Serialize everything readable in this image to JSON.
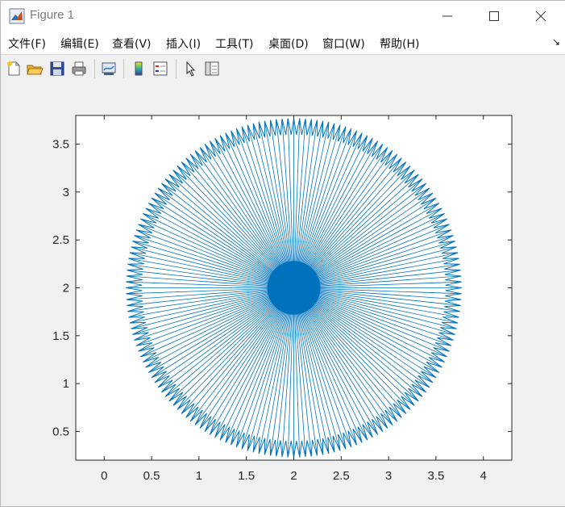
{
  "window": {
    "title": "Figure 1",
    "controls": {
      "minimize": "minimize-icon",
      "maximize": "maximize-icon",
      "close": "close-icon"
    }
  },
  "menu": {
    "items": [
      {
        "label": "文件(F)"
      },
      {
        "label": "编辑(E)"
      },
      {
        "label": "查看(V)"
      },
      {
        "label": "插入(I)"
      },
      {
        "label": "工具(T)"
      },
      {
        "label": "桌面(D)"
      },
      {
        "label": "窗口(W)"
      },
      {
        "label": "帮助(H)"
      }
    ],
    "overflow_icon": "dock-arrow-icon"
  },
  "toolbar": {
    "buttons": [
      "new-figure-icon",
      "open-file-icon",
      "save-icon",
      "print-icon",
      "link-plot-icon",
      "insert-colorbar-icon",
      "insert-legend-icon",
      "edit-plot-pointer-icon",
      "property-inspector-icon"
    ]
  },
  "chart_data": {
    "type": "line",
    "title": "",
    "xlabel": "",
    "ylabel": "",
    "xlim": [
      -0.3,
      4.3
    ],
    "ylim": [
      0.2,
      3.8
    ],
    "x_ticks": [
      "0",
      "0.5",
      "1",
      "1.5",
      "2",
      "2.5",
      "3",
      "3.5",
      "4"
    ],
    "y_ticks": [
      "0.5",
      "1",
      "1.5",
      "2",
      "2.5",
      "3",
      "3.5"
    ],
    "grid": false,
    "line_color": "#0072BD",
    "series": [
      {
        "description_of_shape": "star burst of spokes from center to outer zig-zag ring",
        "center": [
          2,
          2
        ],
        "outer_radius": 1.77,
        "inner_ring_radius": 1.6,
        "spoke_count": 180
      }
    ]
  },
  "colors": {
    "plot_line": "#0072BD",
    "axes_bg": "#ffffff",
    "figure_bg": "#f0f0f0"
  }
}
